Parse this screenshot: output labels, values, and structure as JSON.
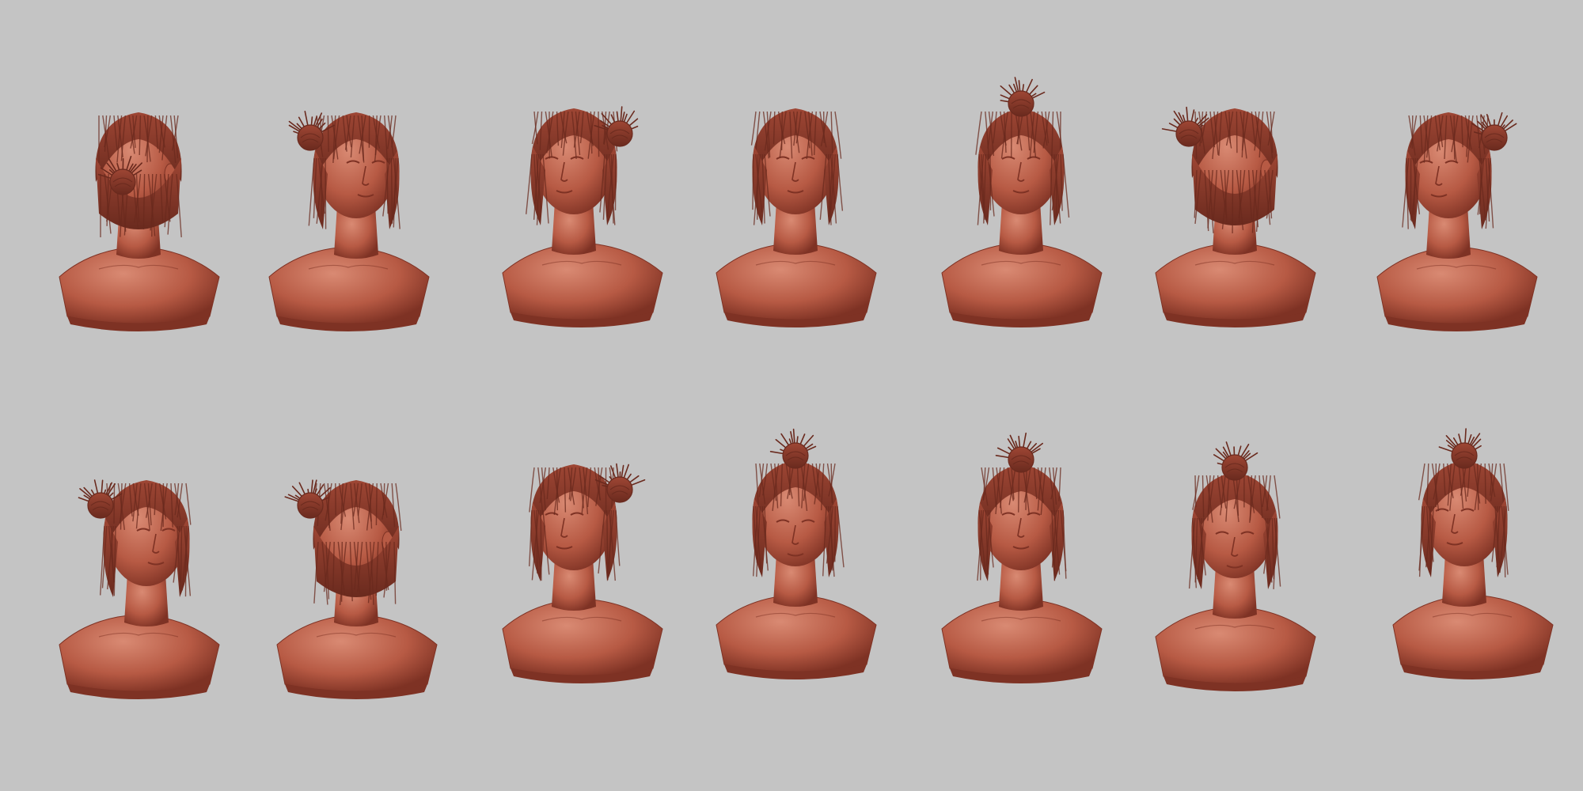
{
  "scene": {
    "background_color": "#c4c4c4",
    "clay_color": "#b75a44",
    "clay_shadow": "#7e3224",
    "clay_light": "#d98a73",
    "hair_color": "#9e4634",
    "hair_line": "#6a2a1e",
    "rows": 2,
    "columns": 7,
    "description_hidden": ""
  },
  "views": [
    {
      "id": "r1c1",
      "view": "back-left",
      "facing": "back",
      "bun": "back"
    },
    {
      "id": "r1c2",
      "view": "three-quarter-right",
      "facing": "right",
      "bun": "left"
    },
    {
      "id": "r1c3",
      "view": "profile-left",
      "facing": "left",
      "bun": "right"
    },
    {
      "id": "r1c4",
      "view": "front",
      "facing": "front",
      "bun": "none"
    },
    {
      "id": "r1c5",
      "view": "front",
      "facing": "front",
      "bun": "top"
    },
    {
      "id": "r1c6",
      "view": "back-right",
      "facing": "back",
      "bun": "left"
    },
    {
      "id": "r1c7",
      "view": "three-quarter-left-tilted",
      "facing": "left",
      "bun": "right"
    },
    {
      "id": "r2c1",
      "view": "three-quarter-right",
      "facing": "right",
      "bun": "left"
    },
    {
      "id": "r2c2",
      "view": "back-left-tilted",
      "facing": "back",
      "bun": "left"
    },
    {
      "id": "r2c3",
      "view": "three-quarter-left",
      "facing": "left",
      "bun": "right"
    },
    {
      "id": "r2c4",
      "view": "top-down-right",
      "facing": "down-right",
      "bun": "top"
    },
    {
      "id": "r2c5",
      "view": "front",
      "facing": "front",
      "bun": "top"
    },
    {
      "id": "r2c6",
      "view": "top-down",
      "facing": "down",
      "bun": "top"
    },
    {
      "id": "r2c7",
      "view": "three-quarter-left",
      "facing": "left",
      "bun": "top"
    }
  ]
}
